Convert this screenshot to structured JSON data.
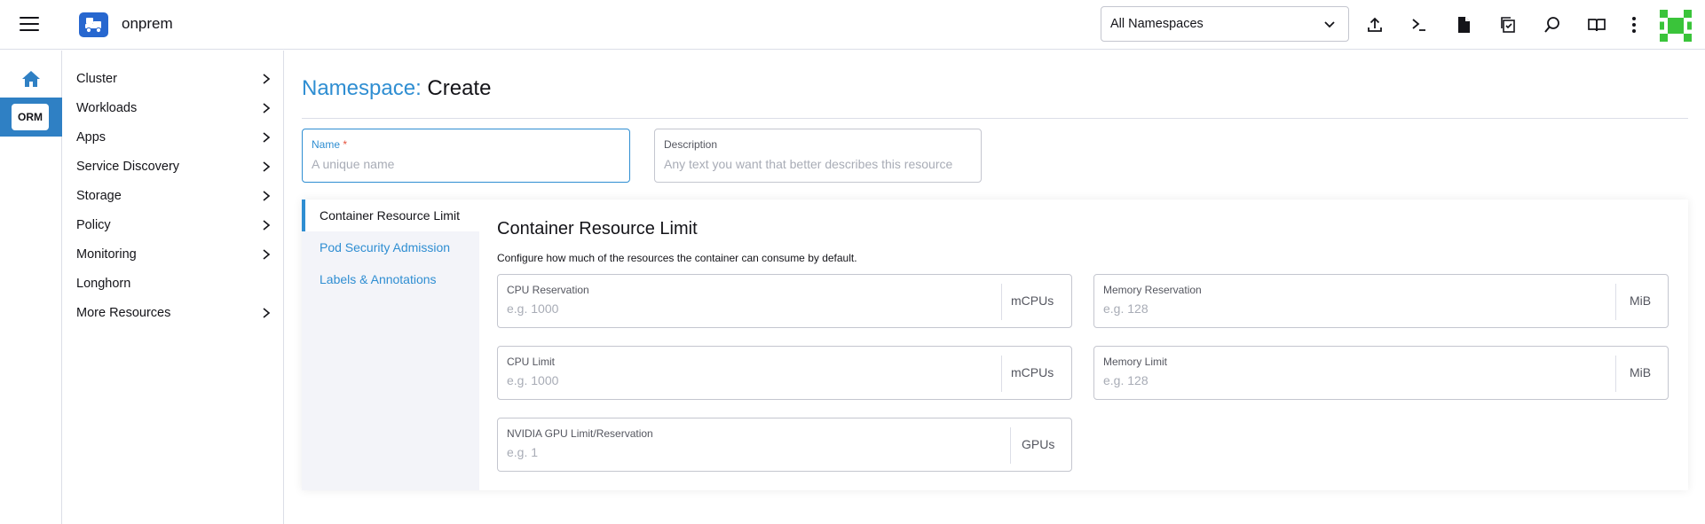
{
  "header": {
    "cluster_name": "onprem",
    "namespace_select": "All Namespaces",
    "icons": [
      "import-yaml-icon",
      "kubectl-shell-icon",
      "kubeconfig-file-icon",
      "copy-kubeconfig-icon",
      "search-icon",
      "docs-book-icon",
      "more-vertical-icon"
    ],
    "colors": {
      "brand": "#2767cf",
      "accent": "#2f8ed2",
      "avatar": "#3ac43a"
    }
  },
  "rail": {
    "home_icon": "home-icon",
    "active_cluster_badge": "ORM",
    "active_color": "#2f80c4"
  },
  "nav": {
    "items": [
      {
        "label": "Cluster",
        "expandable": true
      },
      {
        "label": "Workloads",
        "expandable": true
      },
      {
        "label": "Apps",
        "expandable": true
      },
      {
        "label": "Service Discovery",
        "expandable": true
      },
      {
        "label": "Storage",
        "expandable": true
      },
      {
        "label": "Policy",
        "expandable": true
      },
      {
        "label": "Monitoring",
        "expandable": true
      },
      {
        "label": "Longhorn",
        "expandable": false
      },
      {
        "label": "More Resources",
        "expandable": true
      }
    ]
  },
  "page": {
    "title_prefix": "Namespace:",
    "title_action": "Create",
    "name_field": {
      "label": "Name",
      "required_mark": "*",
      "placeholder": "A unique name",
      "value": ""
    },
    "description_field": {
      "label": "Description",
      "placeholder": "Any text you want that better describes this resource",
      "value": ""
    }
  },
  "tabs": {
    "items": [
      {
        "label": "Container Resource Limit",
        "active": true
      },
      {
        "label": "Pod Security Admission",
        "active": false
      },
      {
        "label": "Labels & Annotations",
        "active": false
      }
    ]
  },
  "container_limits": {
    "title": "Container Resource Limit",
    "description": "Configure how much of the resources the container can consume by default.",
    "cpu_reservation": {
      "label": "CPU Reservation",
      "placeholder": "e.g. 1000",
      "unit": "mCPUs"
    },
    "memory_reservation": {
      "label": "Memory Reservation",
      "placeholder": "e.g. 128",
      "unit": "MiB"
    },
    "cpu_limit": {
      "label": "CPU Limit",
      "placeholder": "e.g. 1000",
      "unit": "mCPUs"
    },
    "memory_limit": {
      "label": "Memory Limit",
      "placeholder": "e.g. 128",
      "unit": "MiB"
    },
    "gpu_limit": {
      "label": "NVIDIA GPU Limit/Reservation",
      "placeholder": "e.g. 1",
      "unit": "GPUs"
    }
  }
}
